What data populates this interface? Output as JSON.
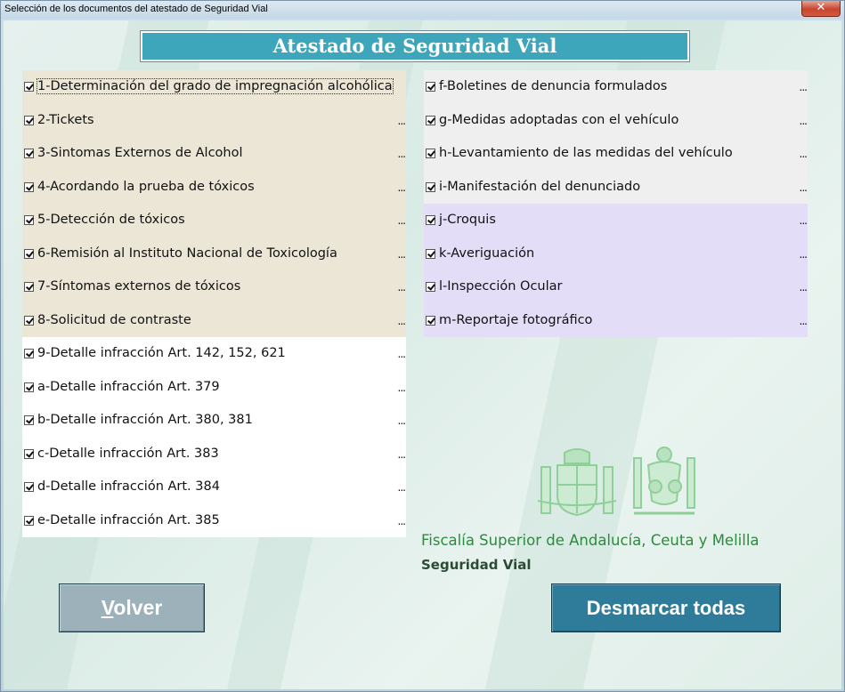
{
  "window": {
    "title": "Selección de los documentos del atestado de Seguridad Vial",
    "close_label": "✕"
  },
  "header": {
    "title": "Atestado de Seguridad Vial"
  },
  "left_column": {
    "group_beige": [
      {
        "label": "1-Determinación del grado de impregnación alcohólica",
        "checked": true,
        "dots": ""
      },
      {
        "label": "2-Tickets",
        "checked": true,
        "dots": "..."
      },
      {
        "label": "3-Sintomas Externos de Alcohol",
        "checked": true,
        "dots": "..."
      },
      {
        "label": "4-Acordando la prueba de tóxicos",
        "checked": true,
        "dots": "..."
      },
      {
        "label": "5-Detección de tóxicos",
        "checked": true,
        "dots": "..."
      },
      {
        "label": "6-Remisión al Instituto Nacional de Toxicología",
        "checked": true,
        "dots": "..."
      },
      {
        "label": "7-Síntomas externos de tóxicos",
        "checked": true,
        "dots": "..."
      },
      {
        "label": "8-Solicitud de contraste",
        "checked": true,
        "dots": "..."
      }
    ],
    "group_white": [
      {
        "label": "9-Detalle infracción Art. 142, 152, 621",
        "checked": true,
        "dots": "..."
      },
      {
        "label": "a-Detalle infracción Art. 379",
        "checked": true,
        "dots": "..."
      },
      {
        "label": "b-Detalle infracción Art. 380, 381",
        "checked": true,
        "dots": "..."
      },
      {
        "label": "c-Detalle infracción Art. 383",
        "checked": true,
        "dots": "..."
      },
      {
        "label": "d-Detalle infracción Art. 384",
        "checked": true,
        "dots": "..."
      },
      {
        "label": "e-Detalle infracción Art. 385",
        "checked": true,
        "dots": "..."
      }
    ]
  },
  "right_column": {
    "group_gray": [
      {
        "label": "f-Boletines de denuncia formulados",
        "checked": true,
        "dots": "..."
      },
      {
        "label": "g-Medidas adoptadas con el vehículo",
        "checked": true,
        "dots": "..."
      },
      {
        "label": "h-Levantamiento de las medidas del vehículo",
        "checked": true,
        "dots": "..."
      },
      {
        "label": "i-Manifestación del denunciado",
        "checked": true,
        "dots": "..."
      }
    ],
    "group_lavender": [
      {
        "label": "j-Croquis",
        "checked": true,
        "dots": "..."
      },
      {
        "label": "k-Averiguación",
        "checked": true,
        "dots": "..."
      },
      {
        "label": "l-Inspección Ocular",
        "checked": true,
        "dots": "..."
      },
      {
        "label": "m-Reportaje fotográfico",
        "checked": true,
        "dots": "..."
      }
    ]
  },
  "footer": {
    "org_name": "Fiscalía Superior de Andalucía, Ceuta y Melilla",
    "org_sub": "Seguridad Vial",
    "volver_first": "V",
    "volver_rest": "olver",
    "desmarcar_label": "Desmarcar todas"
  },
  "colors": {
    "banner": "#3ea6ba",
    "panel_beige": "#ebe6d6",
    "panel_white": "#ffffff",
    "panel_gray": "#efefef",
    "panel_lavender": "#e3ddf8",
    "button_volver": "#9cb1b9",
    "button_desmarcar": "#2f7b9a",
    "org_green": "#2d8a3e"
  }
}
